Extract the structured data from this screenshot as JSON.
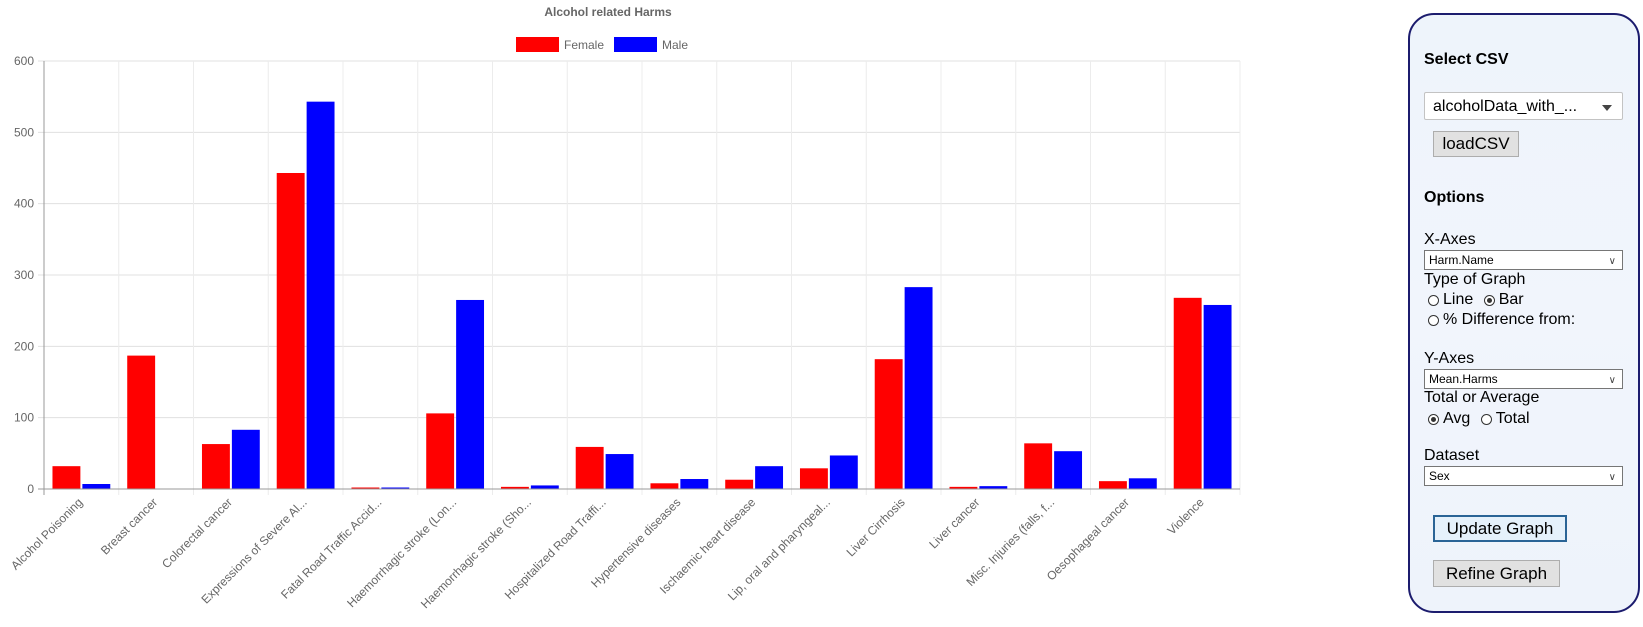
{
  "chart_data": {
    "type": "bar",
    "title": "Alcohol related Harms",
    "xlabel": "",
    "ylabel": "",
    "ylim": [
      0,
      600
    ],
    "yticks": [
      "0",
      "100",
      "200",
      "300",
      "400",
      "500",
      "600"
    ],
    "grid": true,
    "legend_position": "top-center",
    "categories": [
      "Alcohol Poisoning",
      "Breast cancer",
      "Colorectal cancer",
      "Expressions of Severe Al...",
      "Fatal Road Traffic Accid...",
      "Haemorrhagic stroke (Lon...",
      "Haemorrhagic stroke (Sho...",
      "Hospitalized Road Traffi...",
      "Hypertensive diseases",
      "Ischaemic heart disease",
      "Lip, oral and pharyngeal...",
      "Liver Cirrhosis",
      "Liver cancer",
      "Misc. Injuries (falls, f...",
      "Oesophageal cancer",
      "Violence"
    ],
    "series": [
      {
        "name": "Female",
        "color": "#ff0000",
        "values": [
          32,
          187,
          63,
          443,
          1,
          106,
          3,
          59,
          8,
          13,
          29,
          182,
          3,
          64,
          11,
          268
        ]
      },
      {
        "name": "Male",
        "color": "#0000ff",
        "values": [
          7,
          0,
          83,
          543,
          1,
          265,
          5,
          49,
          14,
          32,
          47,
          283,
          4,
          53,
          15,
          258
        ]
      }
    ]
  },
  "panel": {
    "select_csv_heading": "Select CSV",
    "csv_file_value": "alcoholData_with_...",
    "load_csv_label": "loadCSV",
    "options_heading": "Options",
    "x_axes_label": "X-Axes",
    "x_axes_value": "Harm.Name",
    "type_of_graph_label": "Type of Graph",
    "graph_types": [
      {
        "label": "Line",
        "checked": false
      },
      {
        "label": "Bar",
        "checked": true
      },
      {
        "label": "% Difference from:",
        "checked": false
      }
    ],
    "y_axes_label": "Y-Axes",
    "y_axes_value": "Mean.Harms",
    "total_or_average_label": "Total or Average",
    "aggregations": [
      {
        "label": "Avg",
        "checked": true
      },
      {
        "label": "Total",
        "checked": false
      }
    ],
    "dataset_label": "Dataset",
    "dataset_value": "Sex",
    "update_graph_label": "Update Graph",
    "refine_graph_label": "Refine Graph",
    "icons": {
      "csv_dropdown": "caret-down-icon",
      "select_dropdown": "chevron-down-icon"
    }
  }
}
